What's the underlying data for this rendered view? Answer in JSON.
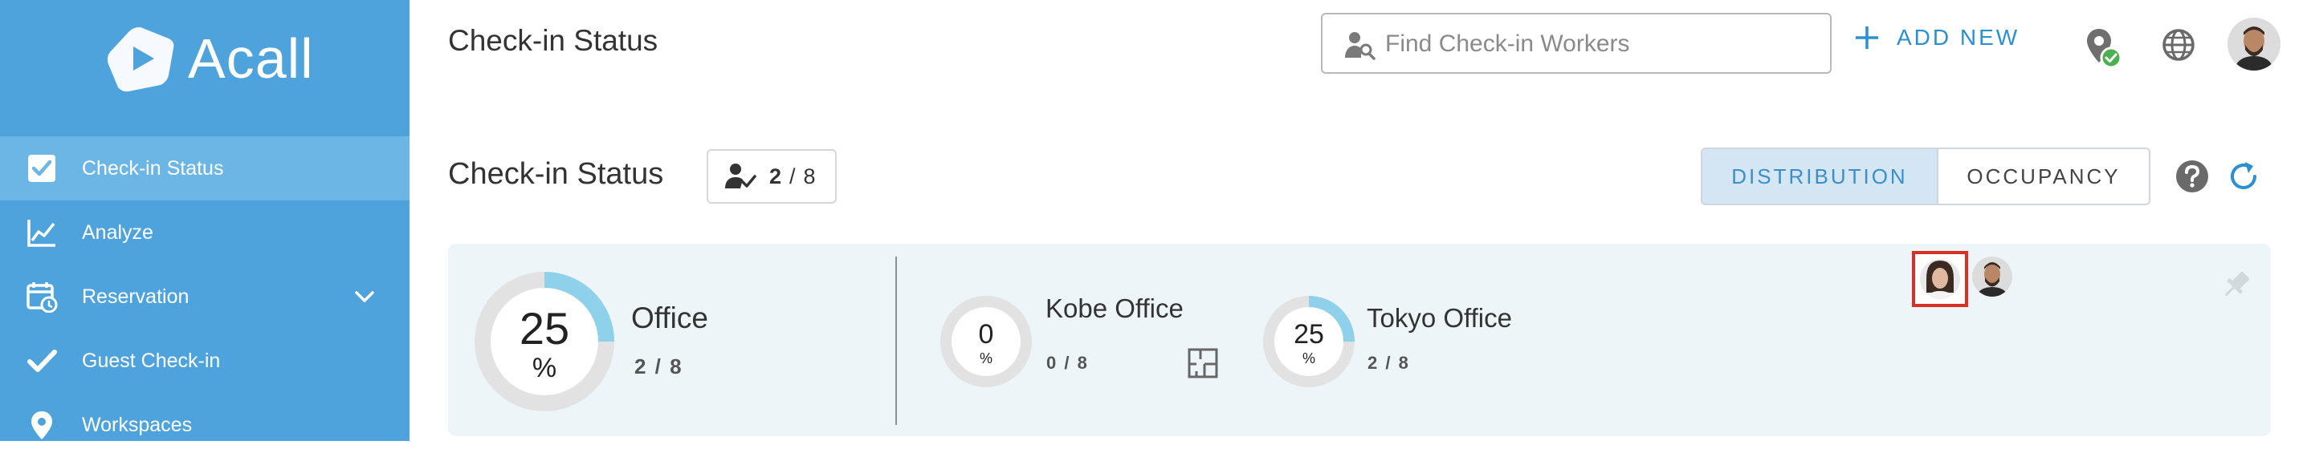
{
  "app": {
    "name": "Acall"
  },
  "sidebar": {
    "items": [
      {
        "label": "Check-in Status",
        "icon": "checkbox-icon",
        "active": true
      },
      {
        "label": "Analyze",
        "icon": "line-chart-icon",
        "active": false
      },
      {
        "label": "Reservation",
        "icon": "calendar-clock-icon",
        "active": false,
        "has_submenu": true
      },
      {
        "label": "Guest Check-in",
        "icon": "checkmark-icon",
        "active": false
      },
      {
        "label": "Workspaces",
        "icon": "location-pin-icon",
        "active": false
      }
    ]
  },
  "header": {
    "title": "Check-in Status",
    "search": {
      "placeholder": "Find Check-in Workers",
      "value": ""
    },
    "add_new_label": "ADD NEW"
  },
  "status": {
    "title": "Check-in Status",
    "checked_in": "2",
    "separator": "/",
    "total": "8",
    "views": {
      "distribution": "DISTRIBUTION",
      "occupancy": "OCCUPANCY",
      "selected": "distribution"
    }
  },
  "summary": {
    "value": "25",
    "unit": "%",
    "name": "Office",
    "count": "2 / 8",
    "fraction": 0.25
  },
  "locations": [
    {
      "name": "Kobe Office",
      "value": "0",
      "unit": "%",
      "count": "0 / 8",
      "fraction": 0,
      "has_floor_map": true
    },
    {
      "name": "Tokyo Office",
      "value": "25",
      "unit": "%",
      "count": "2 / 8",
      "fraction": 0.25,
      "has_floor_map": false
    }
  ],
  "colors": {
    "sidebar": "#4ea3dd",
    "sidebar_active": "#6cb6e6",
    "accent": "#2a90d2",
    "donut_fill": "#8fd1ea",
    "donut_track": "#e2e2e2",
    "card_bg": "#eef5f9",
    "highlight_border": "#d93025",
    "status_ok": "#4caf50"
  }
}
